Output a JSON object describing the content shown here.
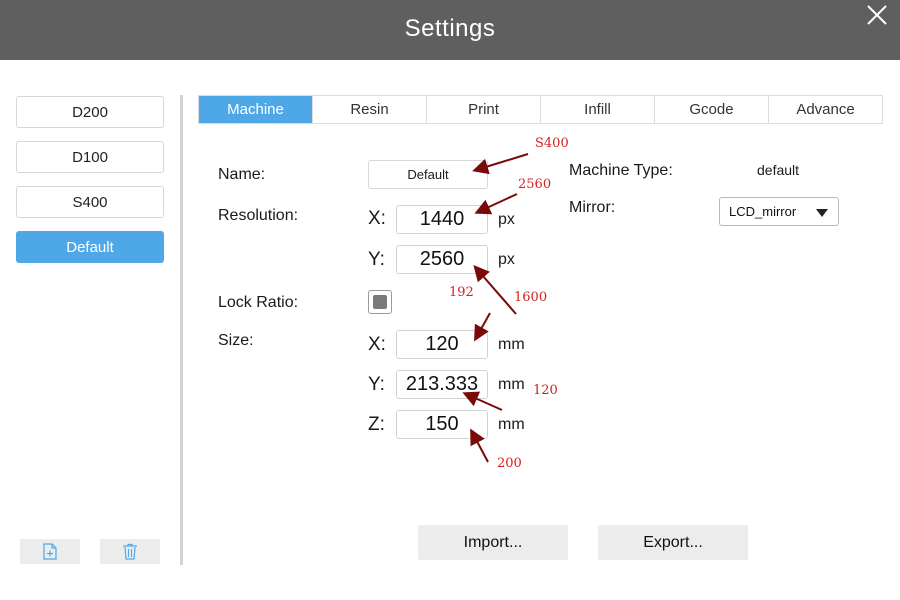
{
  "window": {
    "title": "Settings"
  },
  "sidebar": {
    "profiles": [
      {
        "label": "D200"
      },
      {
        "label": "D100"
      },
      {
        "label": "S400"
      },
      {
        "label": "Default",
        "active": true
      }
    ],
    "actions": [
      {
        "icon": "new-file-icon"
      },
      {
        "icon": "trash-icon"
      }
    ]
  },
  "tabs": [
    {
      "label": "Machine",
      "active": true
    },
    {
      "label": "Resin"
    },
    {
      "label": "Print"
    },
    {
      "label": "Infill"
    },
    {
      "label": "Gcode"
    },
    {
      "label": "Advance"
    }
  ],
  "machine": {
    "name_label": "Name:",
    "name_value": "Default",
    "resolution_label": "Resolution:",
    "res_x_axis": "X:",
    "res_x": "1440",
    "res_x_unit": "px",
    "res_y_axis": "Y:",
    "res_y": "2560",
    "res_y_unit": "px",
    "lock_ratio_label": "Lock Ratio:",
    "lock_ratio_checked": true,
    "size_label": "Size:",
    "size_x_axis": "X:",
    "size_x": "120",
    "size_x_unit": "mm",
    "size_y_axis": "Y:",
    "size_y": "213.333",
    "size_y_unit": "mm",
    "size_z_axis": "Z:",
    "size_z": "150",
    "size_z_unit": "mm",
    "machine_type_label": "Machine Type:",
    "machine_type_value": "default",
    "mirror_label": "Mirror:",
    "mirror_value": "LCD_mirror"
  },
  "footer": {
    "import_label": "Import...",
    "export_label": "Export..."
  },
  "annotations": {
    "name": "S400",
    "res_x": "2560",
    "res_y": "192",
    "size_x": "1600",
    "size_y": "120",
    "size_z": "200"
  },
  "colors": {
    "titlebar": "#5f5f5f",
    "accent": "#4ea8e8",
    "annotation_text": "#d62020",
    "annotation_arrow": "#7a0a0a"
  }
}
